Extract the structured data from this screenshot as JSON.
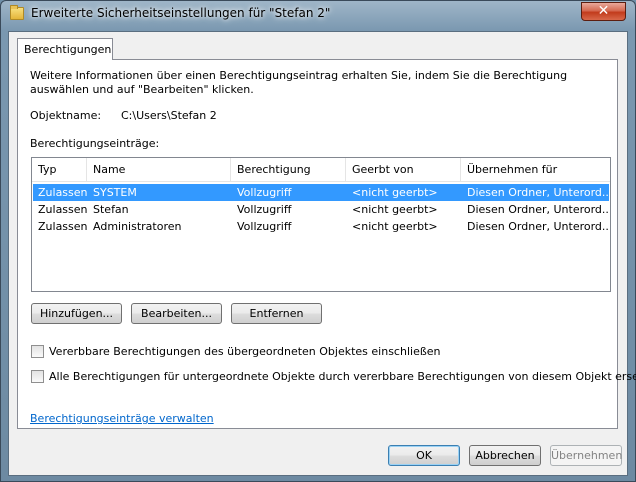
{
  "window": {
    "title": "Erweiterte Sicherheitseinstellungen für \"Stefan 2\"",
    "close_symbol": "✕"
  },
  "tab": {
    "label": "Berechtigungen"
  },
  "info_text": "Weitere Informationen über einen Berechtigungseintrag erhalten Sie, indem Sie die Berechtigung auswählen und auf \"Bearbeiten\" klicken.",
  "object": {
    "label": "Objektname:",
    "value": "C:\\Users\\Stefan 2"
  },
  "entries_label": "Berechtigungseinträge:",
  "table": {
    "columns": [
      "Typ",
      "Name",
      "Berechtigung",
      "Geerbt von",
      "Übernehmen für"
    ],
    "rows": [
      [
        "Zulassen",
        "SYSTEM",
        "Vollzugriff",
        "<nicht geerbt>",
        "Diesen Ordner, Unterord..."
      ],
      [
        "Zulassen",
        "Stefan",
        "Vollzugriff",
        "<nicht geerbt>",
        "Diesen Ordner, Unterord..."
      ],
      [
        "Zulassen",
        "Administratoren",
        "Vollzugriff",
        "<nicht geerbt>",
        "Diesen Ordner, Unterord..."
      ]
    ]
  },
  "buttons": {
    "add": "Hinzufügen...",
    "edit": "Bearbeiten...",
    "remove": "Entfernen",
    "ok": "OK",
    "cancel": "Abbrechen",
    "apply": "Übernehmen"
  },
  "checkboxes": {
    "inherit": "Vererbbare Berechtigungen des übergeordneten Objektes einschließen",
    "replace": "Alle Berechtigungen für untergeordnete Objekte durch vererbbare Berechtigungen von diesem Objekt ersetzen"
  },
  "manage_link": "Berechtigungseinträge verwalten",
  "colors": {
    "selection": "#3399ff",
    "link": "#0066cc",
    "close_button": "#c23b1c"
  }
}
